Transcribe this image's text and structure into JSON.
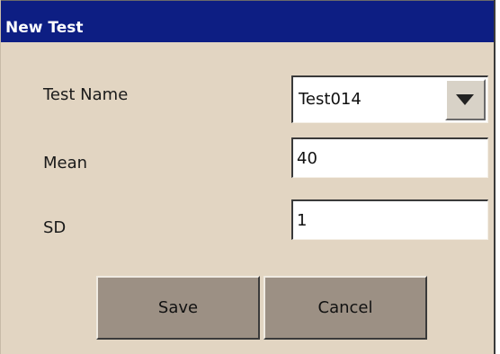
{
  "dialog": {
    "title": "New Test"
  },
  "form": {
    "test_name_label": "Test Name",
    "test_name_value": "Test014",
    "mean_label": "Mean",
    "mean_value": "40",
    "sd_label": "SD",
    "sd_value": "1"
  },
  "buttons": {
    "save_label": "Save",
    "cancel_label": "Cancel"
  },
  "icons": {
    "dropdown": "chevron-down-icon"
  },
  "colors": {
    "titlebar": "#0d1e83",
    "dialog_bg": "#e2d5c2",
    "button_bg": "#9c9084"
  }
}
